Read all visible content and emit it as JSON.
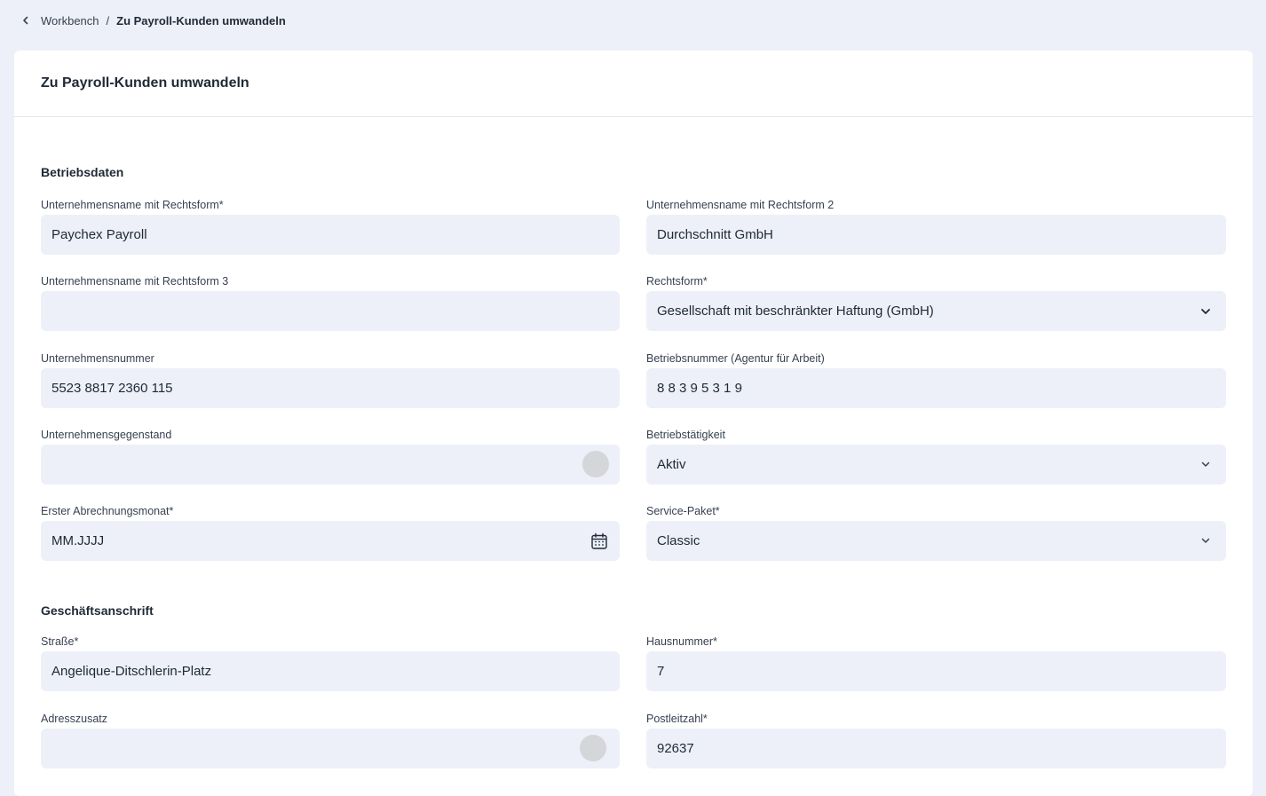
{
  "breadcrumb": {
    "parent": "Workbench",
    "separator": "/",
    "current": "Zu Payroll-Kunden umwandeln"
  },
  "card": {
    "title": "Zu Payroll-Kunden umwandeln"
  },
  "sections": {
    "betriebsdaten": "Betriebsdaten",
    "anschrift": "Geschäftsanschrift"
  },
  "fields": {
    "name1": {
      "label": "Unternehmensname mit Rechtsform*",
      "value": "Paychex Payroll"
    },
    "name2": {
      "label": "Unternehmensname mit Rechtsform 2",
      "value": "Durchschnitt GmbH"
    },
    "name3": {
      "label": "Unternehmensname mit Rechtsform 3",
      "value": ""
    },
    "rechtsform": {
      "label": "Rechtsform*",
      "value": "Gesellschaft mit beschränkter Haftung (GmbH)"
    },
    "unternehmensnummer": {
      "label": "Unternehmensnummer",
      "value": "5523 8817 2360 115"
    },
    "betriebsnummer": {
      "label": "Betriebsnummer (Agentur für Arbeit)",
      "value": "8 8 3 9 5 3 1 9"
    },
    "gegenstand": {
      "label": "Unternehmensgegenstand",
      "value": ""
    },
    "taetigkeit": {
      "label": "Betriebstätigkeit",
      "value": "Aktiv"
    },
    "abrechnungsmonat": {
      "label": "Erster Abrechnungsmonat*",
      "value": "MM.JJJJ"
    },
    "servicepaket": {
      "label": "Service-Paket*",
      "value": "Classic"
    },
    "strasse": {
      "label": "Straße*",
      "value": "Angelique-Ditschlerin-Platz"
    },
    "hausnummer": {
      "label": "Hausnummer*",
      "value": "7"
    },
    "adresszusatz": {
      "label": "Adresszusatz",
      "value": ""
    },
    "postleitzahl": {
      "label": "Postleitzahl*",
      "value": "92637"
    }
  },
  "icons": {
    "back": "chevron-left-icon",
    "dropdown": "chevron-down-icon",
    "calendar": "calendar-icon"
  }
}
